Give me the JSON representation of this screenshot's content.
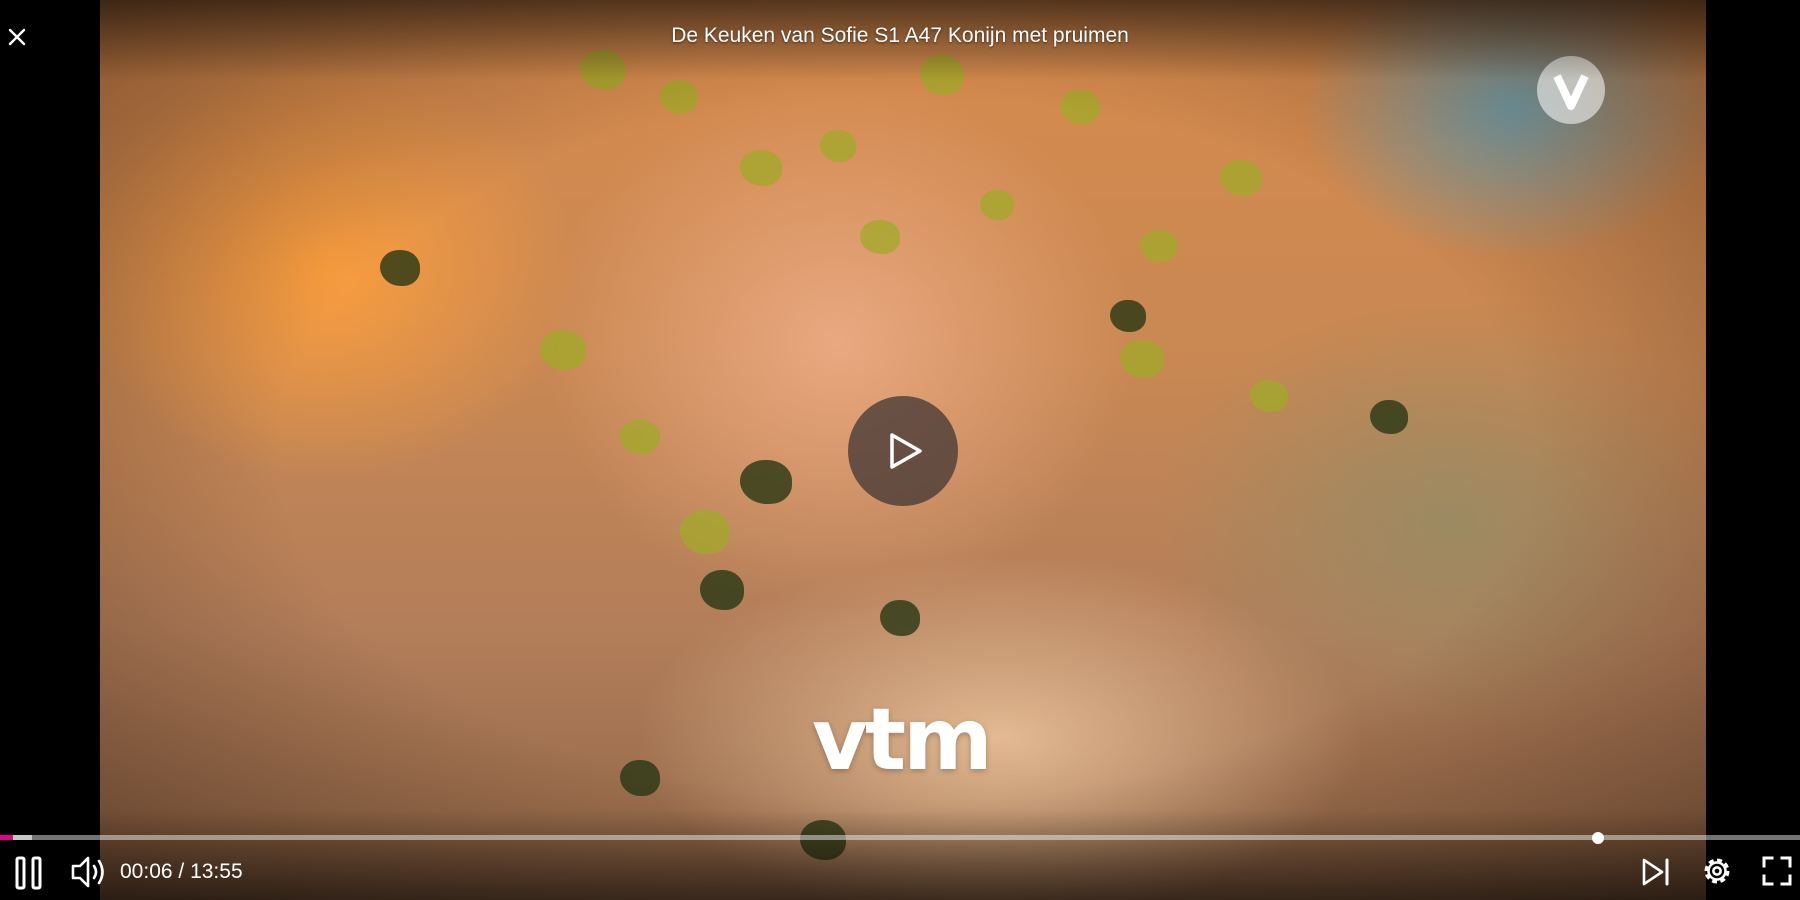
{
  "header": {
    "title": "De Keuken van Sofie S1 A47 Konijn met pruimen"
  },
  "video": {
    "logo_text": "vtm"
  },
  "playback": {
    "current_time": "00:06",
    "separator": " / ",
    "duration": "13:55",
    "progress_fraction": 0.0072,
    "buffered_fraction": 0.018
  },
  "icons": {
    "close": "close-icon",
    "center_play": "play-icon",
    "pause": "pause-icon",
    "volume": "volume-icon",
    "next": "skip-next-icon",
    "settings": "gear-icon",
    "fullscreen": "fullscreen-icon",
    "watermark": "channel-logo-icon"
  },
  "colors": {
    "accent": "#e6008a",
    "background": "#000000",
    "text": "#ffffff"
  }
}
